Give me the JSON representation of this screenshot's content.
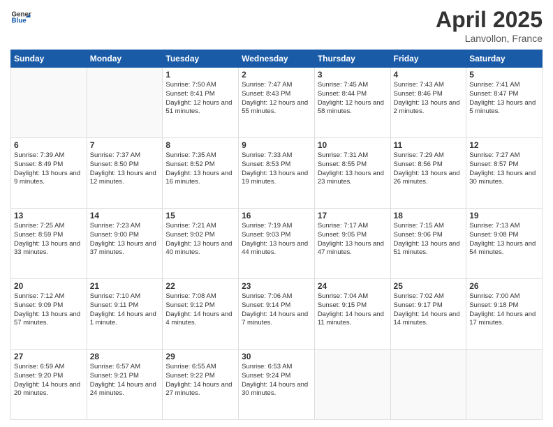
{
  "header": {
    "logo_general": "General",
    "logo_blue": "Blue",
    "month_year": "April 2025",
    "location": "Lanvollon, France"
  },
  "weekdays": [
    "Sunday",
    "Monday",
    "Tuesday",
    "Wednesday",
    "Thursday",
    "Friday",
    "Saturday"
  ],
  "weeks": [
    [
      {
        "day": "",
        "info": ""
      },
      {
        "day": "",
        "info": ""
      },
      {
        "day": "1",
        "info": "Sunrise: 7:50 AM\nSunset: 8:41 PM\nDaylight: 12 hours and 51 minutes."
      },
      {
        "day": "2",
        "info": "Sunrise: 7:47 AM\nSunset: 8:43 PM\nDaylight: 12 hours and 55 minutes."
      },
      {
        "day": "3",
        "info": "Sunrise: 7:45 AM\nSunset: 8:44 PM\nDaylight: 12 hours and 58 minutes."
      },
      {
        "day": "4",
        "info": "Sunrise: 7:43 AM\nSunset: 8:46 PM\nDaylight: 13 hours and 2 minutes."
      },
      {
        "day": "5",
        "info": "Sunrise: 7:41 AM\nSunset: 8:47 PM\nDaylight: 13 hours and 5 minutes."
      }
    ],
    [
      {
        "day": "6",
        "info": "Sunrise: 7:39 AM\nSunset: 8:49 PM\nDaylight: 13 hours and 9 minutes."
      },
      {
        "day": "7",
        "info": "Sunrise: 7:37 AM\nSunset: 8:50 PM\nDaylight: 13 hours and 12 minutes."
      },
      {
        "day": "8",
        "info": "Sunrise: 7:35 AM\nSunset: 8:52 PM\nDaylight: 13 hours and 16 minutes."
      },
      {
        "day": "9",
        "info": "Sunrise: 7:33 AM\nSunset: 8:53 PM\nDaylight: 13 hours and 19 minutes."
      },
      {
        "day": "10",
        "info": "Sunrise: 7:31 AM\nSunset: 8:55 PM\nDaylight: 13 hours and 23 minutes."
      },
      {
        "day": "11",
        "info": "Sunrise: 7:29 AM\nSunset: 8:56 PM\nDaylight: 13 hours and 26 minutes."
      },
      {
        "day": "12",
        "info": "Sunrise: 7:27 AM\nSunset: 8:57 PM\nDaylight: 13 hours and 30 minutes."
      }
    ],
    [
      {
        "day": "13",
        "info": "Sunrise: 7:25 AM\nSunset: 8:59 PM\nDaylight: 13 hours and 33 minutes."
      },
      {
        "day": "14",
        "info": "Sunrise: 7:23 AM\nSunset: 9:00 PM\nDaylight: 13 hours and 37 minutes."
      },
      {
        "day": "15",
        "info": "Sunrise: 7:21 AM\nSunset: 9:02 PM\nDaylight: 13 hours and 40 minutes."
      },
      {
        "day": "16",
        "info": "Sunrise: 7:19 AM\nSunset: 9:03 PM\nDaylight: 13 hours and 44 minutes."
      },
      {
        "day": "17",
        "info": "Sunrise: 7:17 AM\nSunset: 9:05 PM\nDaylight: 13 hours and 47 minutes."
      },
      {
        "day": "18",
        "info": "Sunrise: 7:15 AM\nSunset: 9:06 PM\nDaylight: 13 hours and 51 minutes."
      },
      {
        "day": "19",
        "info": "Sunrise: 7:13 AM\nSunset: 9:08 PM\nDaylight: 13 hours and 54 minutes."
      }
    ],
    [
      {
        "day": "20",
        "info": "Sunrise: 7:12 AM\nSunset: 9:09 PM\nDaylight: 13 hours and 57 minutes."
      },
      {
        "day": "21",
        "info": "Sunrise: 7:10 AM\nSunset: 9:11 PM\nDaylight: 14 hours and 1 minute."
      },
      {
        "day": "22",
        "info": "Sunrise: 7:08 AM\nSunset: 9:12 PM\nDaylight: 14 hours and 4 minutes."
      },
      {
        "day": "23",
        "info": "Sunrise: 7:06 AM\nSunset: 9:14 PM\nDaylight: 14 hours and 7 minutes."
      },
      {
        "day": "24",
        "info": "Sunrise: 7:04 AM\nSunset: 9:15 PM\nDaylight: 14 hours and 11 minutes."
      },
      {
        "day": "25",
        "info": "Sunrise: 7:02 AM\nSunset: 9:17 PM\nDaylight: 14 hours and 14 minutes."
      },
      {
        "day": "26",
        "info": "Sunrise: 7:00 AM\nSunset: 9:18 PM\nDaylight: 14 hours and 17 minutes."
      }
    ],
    [
      {
        "day": "27",
        "info": "Sunrise: 6:59 AM\nSunset: 9:20 PM\nDaylight: 14 hours and 20 minutes."
      },
      {
        "day": "28",
        "info": "Sunrise: 6:57 AM\nSunset: 9:21 PM\nDaylight: 14 hours and 24 minutes."
      },
      {
        "day": "29",
        "info": "Sunrise: 6:55 AM\nSunset: 9:22 PM\nDaylight: 14 hours and 27 minutes."
      },
      {
        "day": "30",
        "info": "Sunrise: 6:53 AM\nSunset: 9:24 PM\nDaylight: 14 hours and 30 minutes."
      },
      {
        "day": "",
        "info": ""
      },
      {
        "day": "",
        "info": ""
      },
      {
        "day": "",
        "info": ""
      }
    ]
  ]
}
